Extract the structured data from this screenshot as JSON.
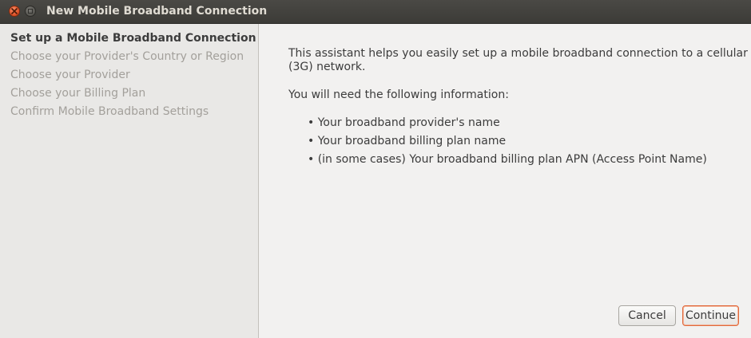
{
  "window": {
    "title": "New Mobile Broadband Connection"
  },
  "sidebar": {
    "steps": [
      {
        "label": "Set up a Mobile Broadband Connection",
        "active": true
      },
      {
        "label": "Choose your Provider's Country or Region",
        "active": false
      },
      {
        "label": "Choose your Provider",
        "active": false
      },
      {
        "label": "Choose your Billing Plan",
        "active": false
      },
      {
        "label": "Confirm Mobile Broadband Settings",
        "active": false
      }
    ]
  },
  "content": {
    "intro": "This assistant helps you easily set up a mobile broadband connection to a cellular (3G) network.",
    "need_info": "You will need the following information:",
    "bullets": [
      "• Your broadband provider's name",
      "• Your broadband billing plan name",
      "• (in some cases) Your broadband billing plan APN (Access Point Name)"
    ]
  },
  "buttons": {
    "cancel": "Cancel",
    "continue": "Continue"
  },
  "colors": {
    "close_button": "#e0542a",
    "focus_ring": "#e0683a"
  }
}
